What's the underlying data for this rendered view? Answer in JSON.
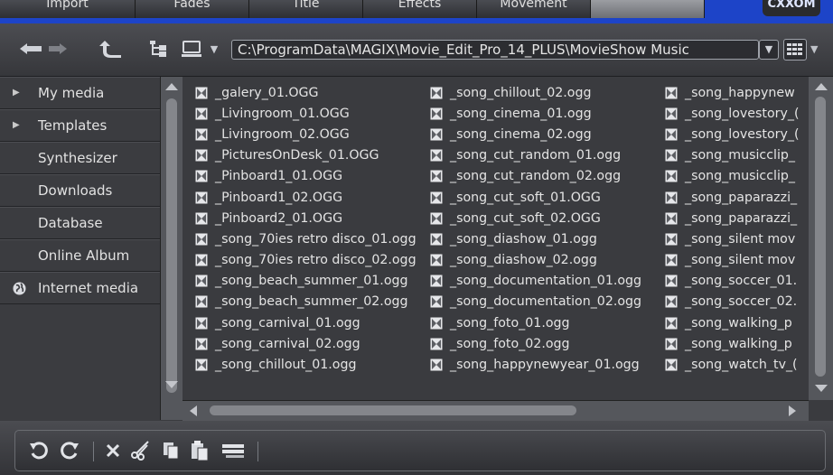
{
  "tabs": [
    {
      "label": "Import",
      "active": false
    },
    {
      "label": "Fades",
      "active": false
    },
    {
      "label": "Title",
      "active": false
    },
    {
      "label": "Effects",
      "active": false
    },
    {
      "label": "Movement",
      "active": false
    },
    {
      "label": "",
      "active": true
    }
  ],
  "brand": {
    "logo_text": "CXXOM"
  },
  "toolbar": {
    "path": "C:\\ProgramData\\MAGIX\\Movie_Edit_Pro_14_PLUS\\MovieShow Music"
  },
  "sidebar": {
    "items": [
      {
        "label": "My media",
        "icon": "expand-arrow-icon"
      },
      {
        "label": "Templates",
        "icon": "expand-arrow-icon"
      },
      {
        "label": "Synthesizer",
        "icon": ""
      },
      {
        "label": "Downloads",
        "icon": ""
      },
      {
        "label": "Database",
        "icon": ""
      },
      {
        "label": "Online Album",
        "icon": ""
      },
      {
        "label": "Internet media",
        "icon": "globe-icon"
      }
    ]
  },
  "files": {
    "columns": [
      [
        "_galery_01.OGG",
        "_Livingroom_01.OGG",
        "_Livingroom_02.OGG",
        "_PicturesOnDesk_01.OGG",
        "_Pinboard1_01.OGG",
        "_Pinboard1_02.OGG",
        "_Pinboard2_01.OGG",
        "_song_70ies retro disco_01.ogg",
        "_song_70ies retro disco_02.ogg",
        "_song_beach_summer_01.ogg",
        "_song_beach_summer_02.ogg",
        "_song_carnival_01.ogg",
        "_song_carnival_02.ogg",
        "_song_chillout_01.ogg"
      ],
      [
        "_song_chillout_02.ogg",
        "_song_cinema_01.ogg",
        "_song_cinema_02.ogg",
        "_song_cut_random_01.ogg",
        "_song_cut_random_02.ogg",
        "_song_cut_soft_01.OGG",
        "_song_cut_soft_02.OGG",
        "_song_diashow_01.ogg",
        "_song_diashow_02.ogg",
        "_song_documentation_01.ogg",
        "_song_documentation_02.ogg",
        "_song_foto_01.ogg",
        "_song_foto_02.ogg",
        "_song_happynewyear_01.ogg"
      ],
      [
        "_song_happynew",
        "_song_lovestory_(",
        "_song_lovestory_(",
        "_song_musicclip_",
        "_song_musicclip_",
        "_song_paparazzi_",
        "_song_paparazzi_",
        "_song_silent mov",
        "_song_silent mov",
        "_song_soccer_01.",
        "_song_soccer_02.",
        "_song_walking_p",
        "_song_walking_p",
        "_song_watch_tv_("
      ]
    ]
  },
  "colors": {
    "title_bar": "#1d44c8",
    "panel": "#3a3b3f",
    "scrollbar": "#55575c"
  }
}
